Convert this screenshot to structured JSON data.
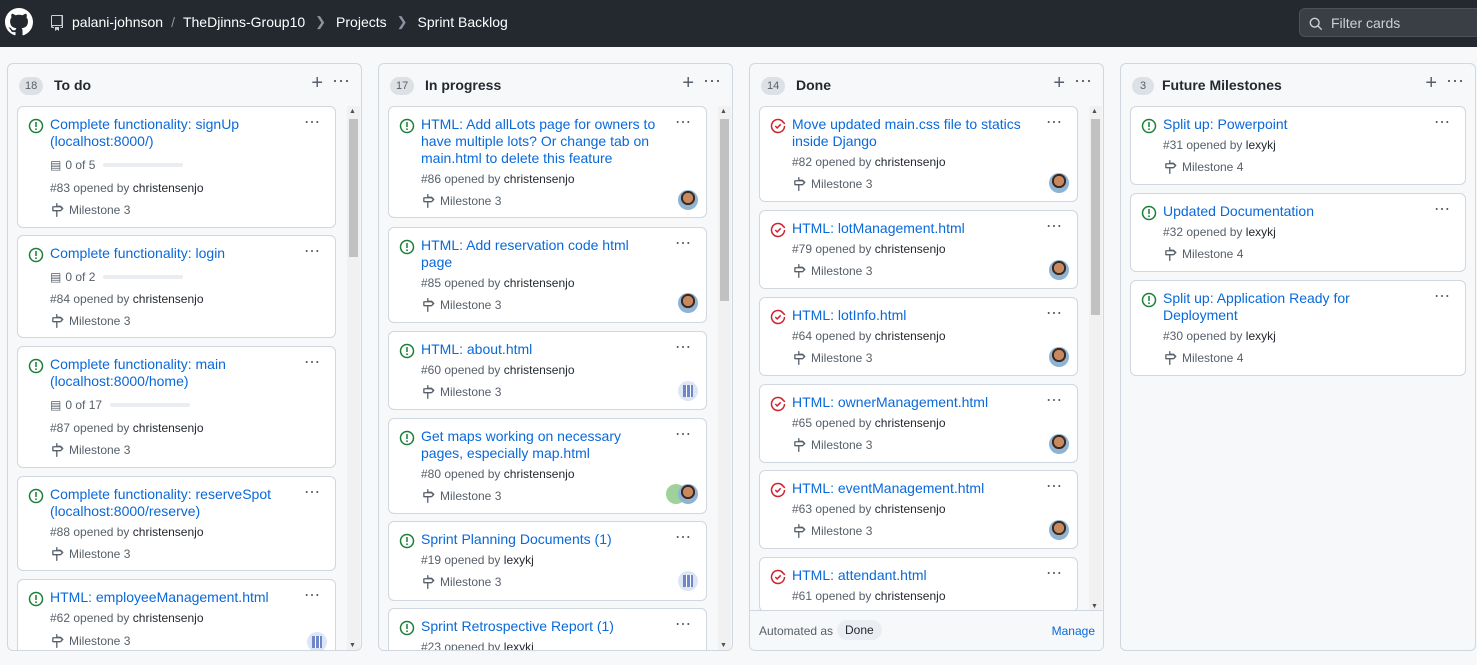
{
  "header": {
    "owner": "palani-johnson",
    "separator": "/",
    "repo": "TheDjinns-Group10",
    "projects": "Projects",
    "board": "Sprint Backlog",
    "filter_placeholder": "Filter cards"
  },
  "icons": {
    "open_color": "#1a7f37",
    "closed_color": "#cf222e",
    "link_color": "#0969da"
  },
  "columns": [
    {
      "count": "18",
      "title": "To do",
      "cards": [
        {
          "title": "Complete functionality: signUp (localhost:8000/)",
          "status": "open",
          "tasks": "0 of 5",
          "number": "#83",
          "opened_by": "opened by",
          "author": "christensenjo",
          "milestone": "Milestone 3"
        },
        {
          "title": "Complete functionality: login",
          "status": "open",
          "tasks": "0 of 2",
          "number": "#84",
          "opened_by": "opened by",
          "author": "christensenjo",
          "milestone": "Milestone 3"
        },
        {
          "title": "Complete functionality: main (localhost:8000/home)",
          "status": "open",
          "tasks": "0 of 17",
          "number": "#87",
          "opened_by": "opened by",
          "author": "christensenjo",
          "milestone": "Milestone 3"
        },
        {
          "title": "Complete functionality: reserveSpot (localhost:8000/reserve)",
          "status": "open",
          "number": "#88",
          "opened_by": "opened by",
          "author": "christensenjo",
          "milestone": "Milestone 3"
        },
        {
          "title": "HTML: employeeManagement.html",
          "status": "open",
          "number": "#62",
          "opened_by": "opened by",
          "author": "christensenjo",
          "milestone": "Milestone 3"
        }
      ]
    },
    {
      "count": "17",
      "title": "In progress",
      "cards": [
        {
          "title": "HTML: Add allLots page for owners to have multiple lots? Or change tab on main.html to delete this feature",
          "status": "open",
          "number": "#86",
          "opened_by": "opened by",
          "author": "christensenjo",
          "milestone": "Milestone 3"
        },
        {
          "title": "HTML: Add reservation code html page",
          "status": "open",
          "number": "#85",
          "opened_by": "opened by",
          "author": "christensenjo",
          "milestone": "Milestone 3"
        },
        {
          "title": "HTML: about.html",
          "status": "open",
          "number": "#60",
          "opened_by": "opened by",
          "author": "christensenjo",
          "milestone": "Milestone 3"
        },
        {
          "title": "Get maps working on necessary pages, especially map.html",
          "status": "open",
          "number": "#80",
          "opened_by": "opened by",
          "author": "christensenjo",
          "milestone": "Milestone 3"
        },
        {
          "title": "Sprint Planning Documents (1)",
          "status": "open",
          "number": "#19",
          "opened_by": "opened by",
          "author": "lexykj",
          "milestone": "Milestone 3"
        },
        {
          "title": "Sprint Retrospective Report (1)",
          "status": "open",
          "number": "#23",
          "opened_by": "opened by",
          "author": "lexykj",
          "milestone": ""
        }
      ]
    },
    {
      "count": "14",
      "title": "Done",
      "cards": [
        {
          "title": "Move updated main.css file to statics inside Django",
          "status": "closed",
          "number": "#82",
          "opened_by": "opened by",
          "author": "christensenjo",
          "milestone": "Milestone 3"
        },
        {
          "title": "HTML: lotManagement.html",
          "status": "closed",
          "number": "#79",
          "opened_by": "opened by",
          "author": "christensenjo",
          "milestone": "Milestone 3"
        },
        {
          "title": "HTML: lotInfo.html",
          "status": "closed",
          "number": "#64",
          "opened_by": "opened by",
          "author": "christensenjo",
          "milestone": "Milestone 3"
        },
        {
          "title": "HTML: ownerManagement.html",
          "status": "closed",
          "number": "#65",
          "opened_by": "opened by",
          "author": "christensenjo",
          "milestone": "Milestone 3"
        },
        {
          "title": "HTML: eventManagement.html",
          "status": "closed",
          "number": "#63",
          "opened_by": "opened by",
          "author": "christensenjo",
          "milestone": "Milestone 3"
        },
        {
          "title": "HTML: attendant.html",
          "status": "closed",
          "number": "#61",
          "opened_by": "opened by",
          "author": "christensenjo",
          "milestone": ""
        }
      ],
      "footer": {
        "automated_as": "Automated as",
        "state": "Done",
        "manage": "Manage"
      }
    },
    {
      "count": "3",
      "title": "Future Milestones",
      "cards": [
        {
          "title": "Split up: Powerpoint",
          "status": "open",
          "number": "#31",
          "opened_by": "opened by",
          "author": "lexykj",
          "milestone": "Milestone 4"
        },
        {
          "title": "Updated Documentation",
          "status": "open",
          "number": "#32",
          "opened_by": "opened by",
          "author": "lexykj",
          "milestone": "Milestone 4"
        },
        {
          "title": "Split up: Application Ready for Deployment",
          "status": "open",
          "number": "#30",
          "opened_by": "opened by",
          "author": "lexykj",
          "milestone": "Milestone 4"
        }
      ]
    }
  ]
}
